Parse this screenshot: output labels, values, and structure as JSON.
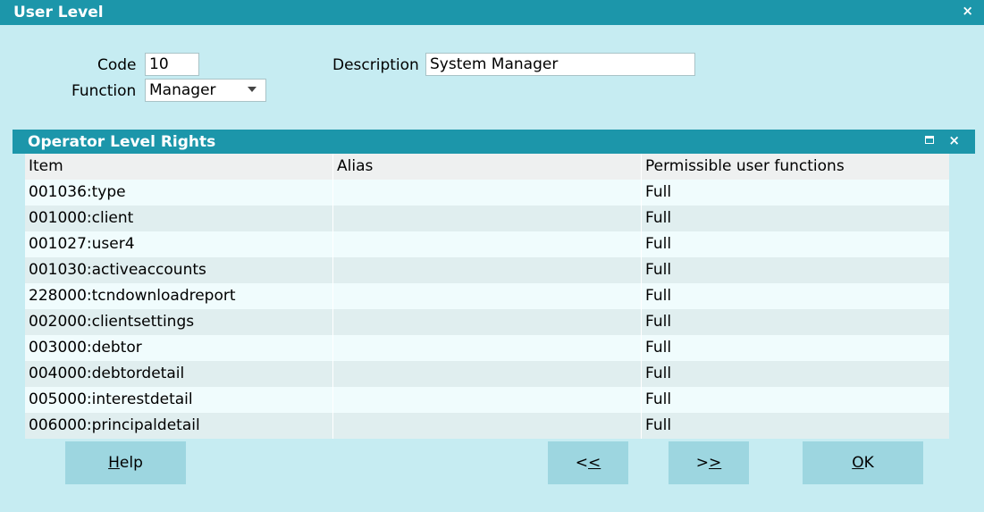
{
  "window": {
    "title": "User Level",
    "close_icon": "×"
  },
  "form": {
    "code_label": "Code",
    "code_value": "10",
    "description_label": "Description",
    "description_value": "System Manager",
    "function_label": "Function",
    "function_value": "Manager"
  },
  "panel": {
    "title": "Operator Level Rights",
    "columns": [
      "Item",
      "Alias",
      "Permissible user functions"
    ],
    "rows": [
      [
        "001036:type",
        "",
        "Full"
      ],
      [
        "001000:client",
        "",
        "Full"
      ],
      [
        "001027:user4",
        "",
        "Full"
      ],
      [
        "001030:activeaccounts",
        "",
        "Full"
      ],
      [
        "228000:tcndownloadreport",
        "",
        "Full"
      ],
      [
        "002000:clientsettings",
        "",
        "Full"
      ],
      [
        "003000:debtor",
        "",
        "Full"
      ],
      [
        "004000:debtordetail",
        "",
        "Full"
      ],
      [
        "005000:interestdetail",
        "",
        "Full"
      ],
      [
        "006000:principaldetail",
        "",
        "Full"
      ]
    ]
  },
  "buttons": {
    "help_accel": "H",
    "help_rest": "elp",
    "prev_lead": "<",
    "prev_accel": "<",
    "next_lead": ">",
    "next_accel": ">",
    "ok_accel": "O",
    "ok_rest": "K"
  },
  "colors": {
    "titlebar": "#1c96aa",
    "background": "#c6ecf2",
    "button": "#9dd6e0"
  }
}
